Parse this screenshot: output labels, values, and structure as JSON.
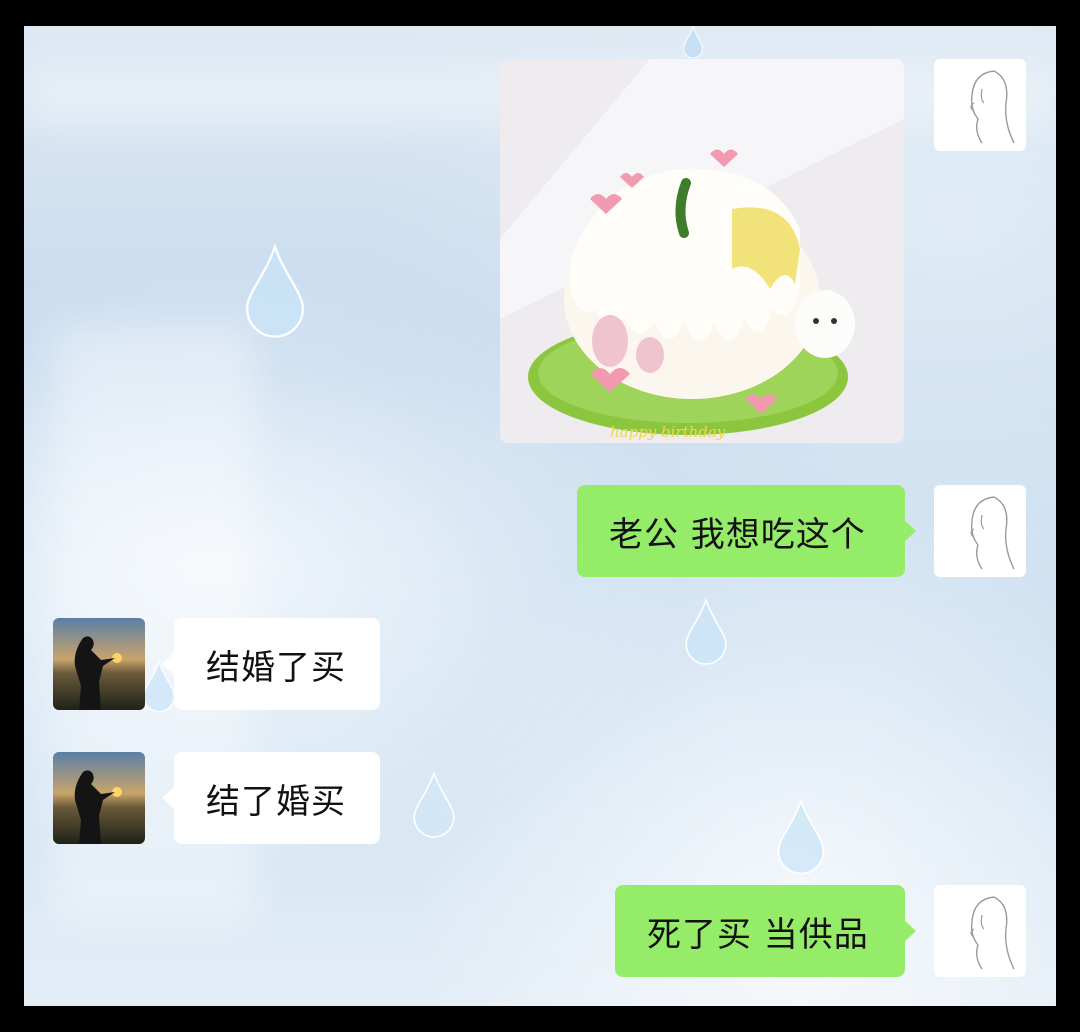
{
  "messages": [
    {
      "sender": "me",
      "type": "image",
      "image_desc": "cake-photo",
      "caption": "happy birthday"
    },
    {
      "sender": "me",
      "type": "text",
      "text": "老公 我想吃这个"
    },
    {
      "sender": "other",
      "type": "text",
      "text": "结婚了买"
    },
    {
      "sender": "other",
      "type": "text",
      "text": "结了婚买"
    },
    {
      "sender": "me",
      "type": "text",
      "text": "死了买 当供品"
    }
  ],
  "colors": {
    "outgoing_bubble": "#95ec69",
    "incoming_bubble": "#ffffff",
    "background": "#cfe0f0"
  },
  "icons": {
    "my_avatar": "line-art-woman-avatar",
    "their_avatar": "sunset-silhouette-avatar",
    "decoration": "raindrop"
  }
}
